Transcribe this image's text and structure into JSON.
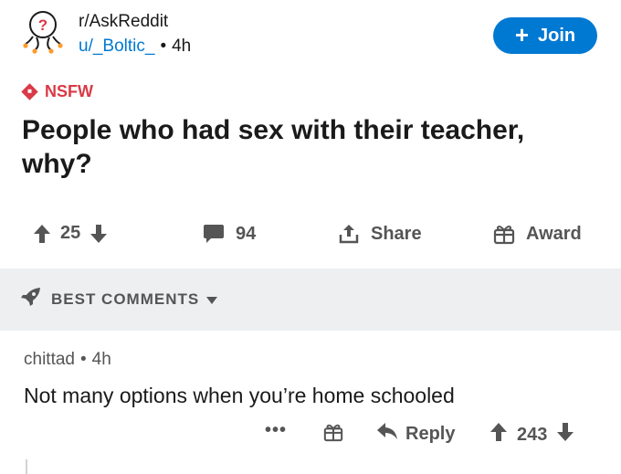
{
  "post": {
    "subreddit": "r/AskReddit",
    "author": "u/_Boltic_",
    "separator": "•",
    "age": "4h",
    "join_label": "Join",
    "nsfw_label": "NSFW",
    "title": "People who had sex with their teacher, why?",
    "vote_count": "25",
    "comment_count": "94",
    "share_label": "Share",
    "award_label": "Award"
  },
  "sort": {
    "label": "BEST COMMENTS"
  },
  "comment": {
    "author": "chittad",
    "separator": "•",
    "age": "4h",
    "body": "Not many options when you’re home schooled",
    "more_label": "•••",
    "reply_label": "Reply",
    "vote_count": "243"
  },
  "colors": {
    "accent": "#0079d3",
    "nsfw": "#d93a46",
    "muted": "#555555",
    "band": "#edeff1"
  }
}
